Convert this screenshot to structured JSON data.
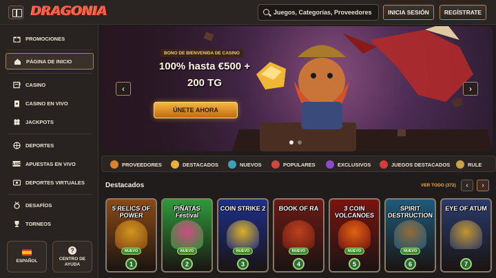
{
  "header": {
    "logo": "DRAGONIA",
    "search_placeholder": "Juegos, Categorías, Proveedores",
    "login_label": "INICIA SESIÓN",
    "register_label": "REGÍSTRATE"
  },
  "sidebar": {
    "items": [
      {
        "label": "PROMOCIONES",
        "icon": "gift-icon"
      },
      {
        "label": "PÁGINA DE INICIO",
        "icon": "home-icon",
        "active": true
      },
      {
        "label": "CASINO",
        "icon": "slot-icon"
      },
      {
        "label": "CASINO EN VIVO",
        "icon": "cards-icon"
      },
      {
        "label": "JACKPOTS",
        "icon": "clover-icon"
      },
      {
        "label": "DEPORTES",
        "icon": "ball-icon"
      },
      {
        "label": "APUESTAS EN VIVO",
        "icon": "live-icon"
      },
      {
        "label": "DEPORTES VIRTUALES",
        "icon": "virtual-icon"
      },
      {
        "label": "DESAFÍOS",
        "icon": "medal-icon"
      },
      {
        "label": "TORNEOS",
        "icon": "trophy-icon"
      }
    ],
    "language_label": "ESPAÑOL",
    "help_label_1": "CENTRO DE",
    "help_label_2": "AYUDA"
  },
  "banner": {
    "tag": "BONO DE BIENVENIDA DE CASINO",
    "line1": "100% hasta €500 +",
    "line2": "200 TG",
    "cta_label": "ÚNETE AHORA",
    "slides_total": 2,
    "active_slide": 1
  },
  "categories": [
    {
      "label": "PROVEEDORES",
      "color": "#d9832a"
    },
    {
      "label": "DESTACADOS",
      "color": "#e7b23a"
    },
    {
      "label": "NUEVOS",
      "color": "#3aa3b8"
    },
    {
      "label": "POPULARES",
      "color": "#d1453b"
    },
    {
      "label": "EXCLUSIVOS",
      "color": "#8a4bd1"
    },
    {
      "label": "JUEGOS DESTACADOS",
      "color": "#d93a3a"
    },
    {
      "label": "RULE",
      "color": "#c9a24a"
    }
  ],
  "featured": {
    "title": "Destacados",
    "see_all": "VER TODO (372)",
    "new_badge": "NUEVO",
    "games": [
      {
        "name": "5 RELICS OF POWER",
        "rank": "1",
        "bg": "#8a4a14",
        "art": "#e0a020"
      },
      {
        "name": "PIÑATAS Festival",
        "rank": "2",
        "bg": "#2f9a3a",
        "art": "#e04a8a"
      },
      {
        "name": "COIN STRIKE 2",
        "rank": "3",
        "bg": "#1d2f8a",
        "art": "#f0c020"
      },
      {
        "name": "BOOK OF RA",
        "rank": "4",
        "bg": "#6a1a14",
        "art": "#c8461e"
      },
      {
        "name": "3 COIN VOLCANOES",
        "rank": "5",
        "bg": "#7a1410",
        "art": "#f06a14"
      },
      {
        "name": "SPIRIT DESTRUCTION",
        "rank": "6",
        "bg": "#1e5a7a",
        "art": "#a0703a"
      },
      {
        "name": "EYE OF ATUM",
        "rank": "7",
        "bg": "#2a3a6a",
        "art": "#d4a030"
      }
    ]
  }
}
